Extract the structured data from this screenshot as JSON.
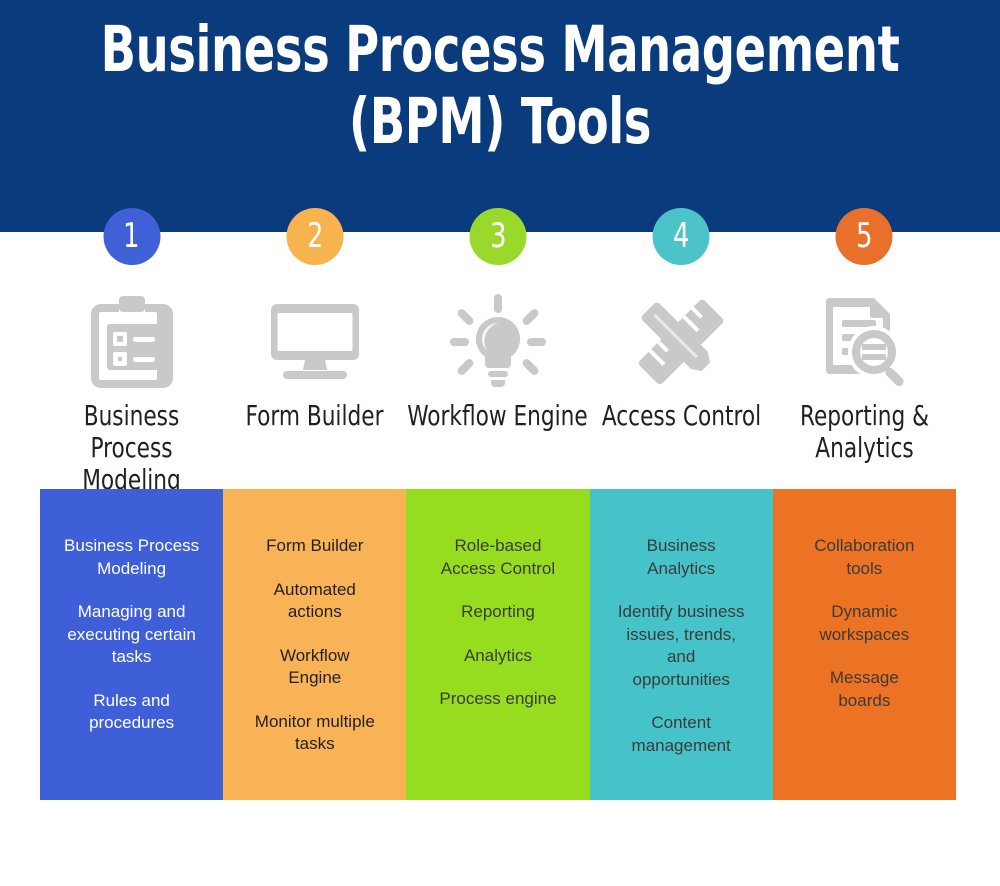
{
  "header": {
    "title": "Business Process Management\n(BPM) Tools",
    "background_color": "#0a3b7c",
    "title_color": "#ffffff"
  },
  "columns": [
    {
      "number": "1",
      "badge_color": "#4060d8",
      "icon": "clipboard-checklist-icon",
      "label": "Business Process\nModeling",
      "panel_color": "#3f5fd8",
      "panel_text_color": "#ffffff",
      "items": [
        "Business Process\nModeling",
        "Managing and\nexecuting certain\ntasks",
        "Rules and\nprocedures"
      ]
    },
    {
      "number": "2",
      "badge_color": "#f7b34e",
      "icon": "monitor-icon",
      "label": "Form Builder",
      "panel_color": "#f9b357",
      "panel_text_color": "#231f20",
      "items": [
        "Form Builder",
        "Automated\nactions",
        "Workflow\nEngine",
        "Monitor multiple\ntasks"
      ]
    },
    {
      "number": "3",
      "badge_color": "#9ad82b",
      "icon": "lightbulb-icon",
      "label": "Workflow Engine",
      "panel_color": "#96dd20",
      "panel_text_color": "#3b3b3b",
      "items": [
        "Role-based\nAccess Control",
        "Reporting",
        "Analytics",
        "Process engine"
      ]
    },
    {
      "number": "4",
      "badge_color": "#4cc2c9",
      "icon": "pencil-ruler-icon",
      "label": "Access Control",
      "panel_color": "#46c3c9",
      "panel_text_color": "#3b3b3b",
      "items": [
        "Business\nAnalytics",
        "Identify business\nissues, trends,\nand\nopportunities",
        "Content\nmanagement"
      ]
    },
    {
      "number": "5",
      "badge_color": "#e8702a",
      "icon": "document-search-icon",
      "label": "Reporting &\nAnalytics",
      "panel_color": "#ec7224",
      "panel_text_color": "#3b3b3b",
      "items": [
        "Collaboration\ntools",
        "Dynamic\nworkspaces",
        "Message\nboards"
      ]
    }
  ],
  "icon_color": "#c9cac8"
}
